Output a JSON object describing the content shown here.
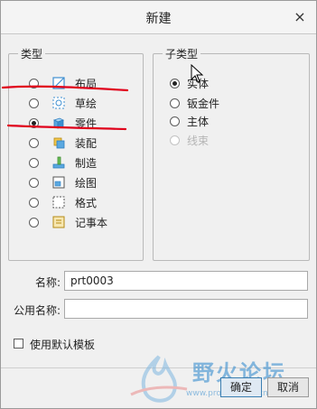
{
  "dialog": {
    "title": "新建",
    "close_glyph": "×"
  },
  "type_group": {
    "legend": "类型",
    "items": [
      {
        "label": "布局",
        "icon": "layout-icon",
        "checked": false
      },
      {
        "label": "草绘",
        "icon": "sketch-icon",
        "checked": false
      },
      {
        "label": "零件",
        "icon": "part-icon",
        "checked": true
      },
      {
        "label": "装配",
        "icon": "assembly-icon",
        "checked": false
      },
      {
        "label": "制造",
        "icon": "manufacturing-icon",
        "checked": false
      },
      {
        "label": "绘图",
        "icon": "drawing-icon",
        "checked": false
      },
      {
        "label": "格式",
        "icon": "format-icon",
        "checked": false
      },
      {
        "label": "记事本",
        "icon": "notebook-icon",
        "checked": false
      }
    ]
  },
  "subtype_group": {
    "legend": "子类型",
    "items": [
      {
        "label": "实体",
        "checked": true,
        "disabled": false
      },
      {
        "label": "钣金件",
        "checked": false,
        "disabled": false
      },
      {
        "label": "主体",
        "checked": false,
        "disabled": false
      },
      {
        "label": "线束",
        "checked": false,
        "disabled": true
      }
    ]
  },
  "name_field": {
    "label": "名称:",
    "value": "prt0003"
  },
  "common_name_field": {
    "label": "公用名称:",
    "value": ""
  },
  "template_checkbox": {
    "label": "使用默认模板",
    "checked": false
  },
  "buttons": {
    "ok": "确定",
    "cancel": "取消"
  },
  "watermark": {
    "text": "野火论坛",
    "url": "www.proewildfire.cn"
  },
  "colors": {
    "annotation_red": "#e0001a",
    "watermark_blue": "#3a8fd0"
  }
}
